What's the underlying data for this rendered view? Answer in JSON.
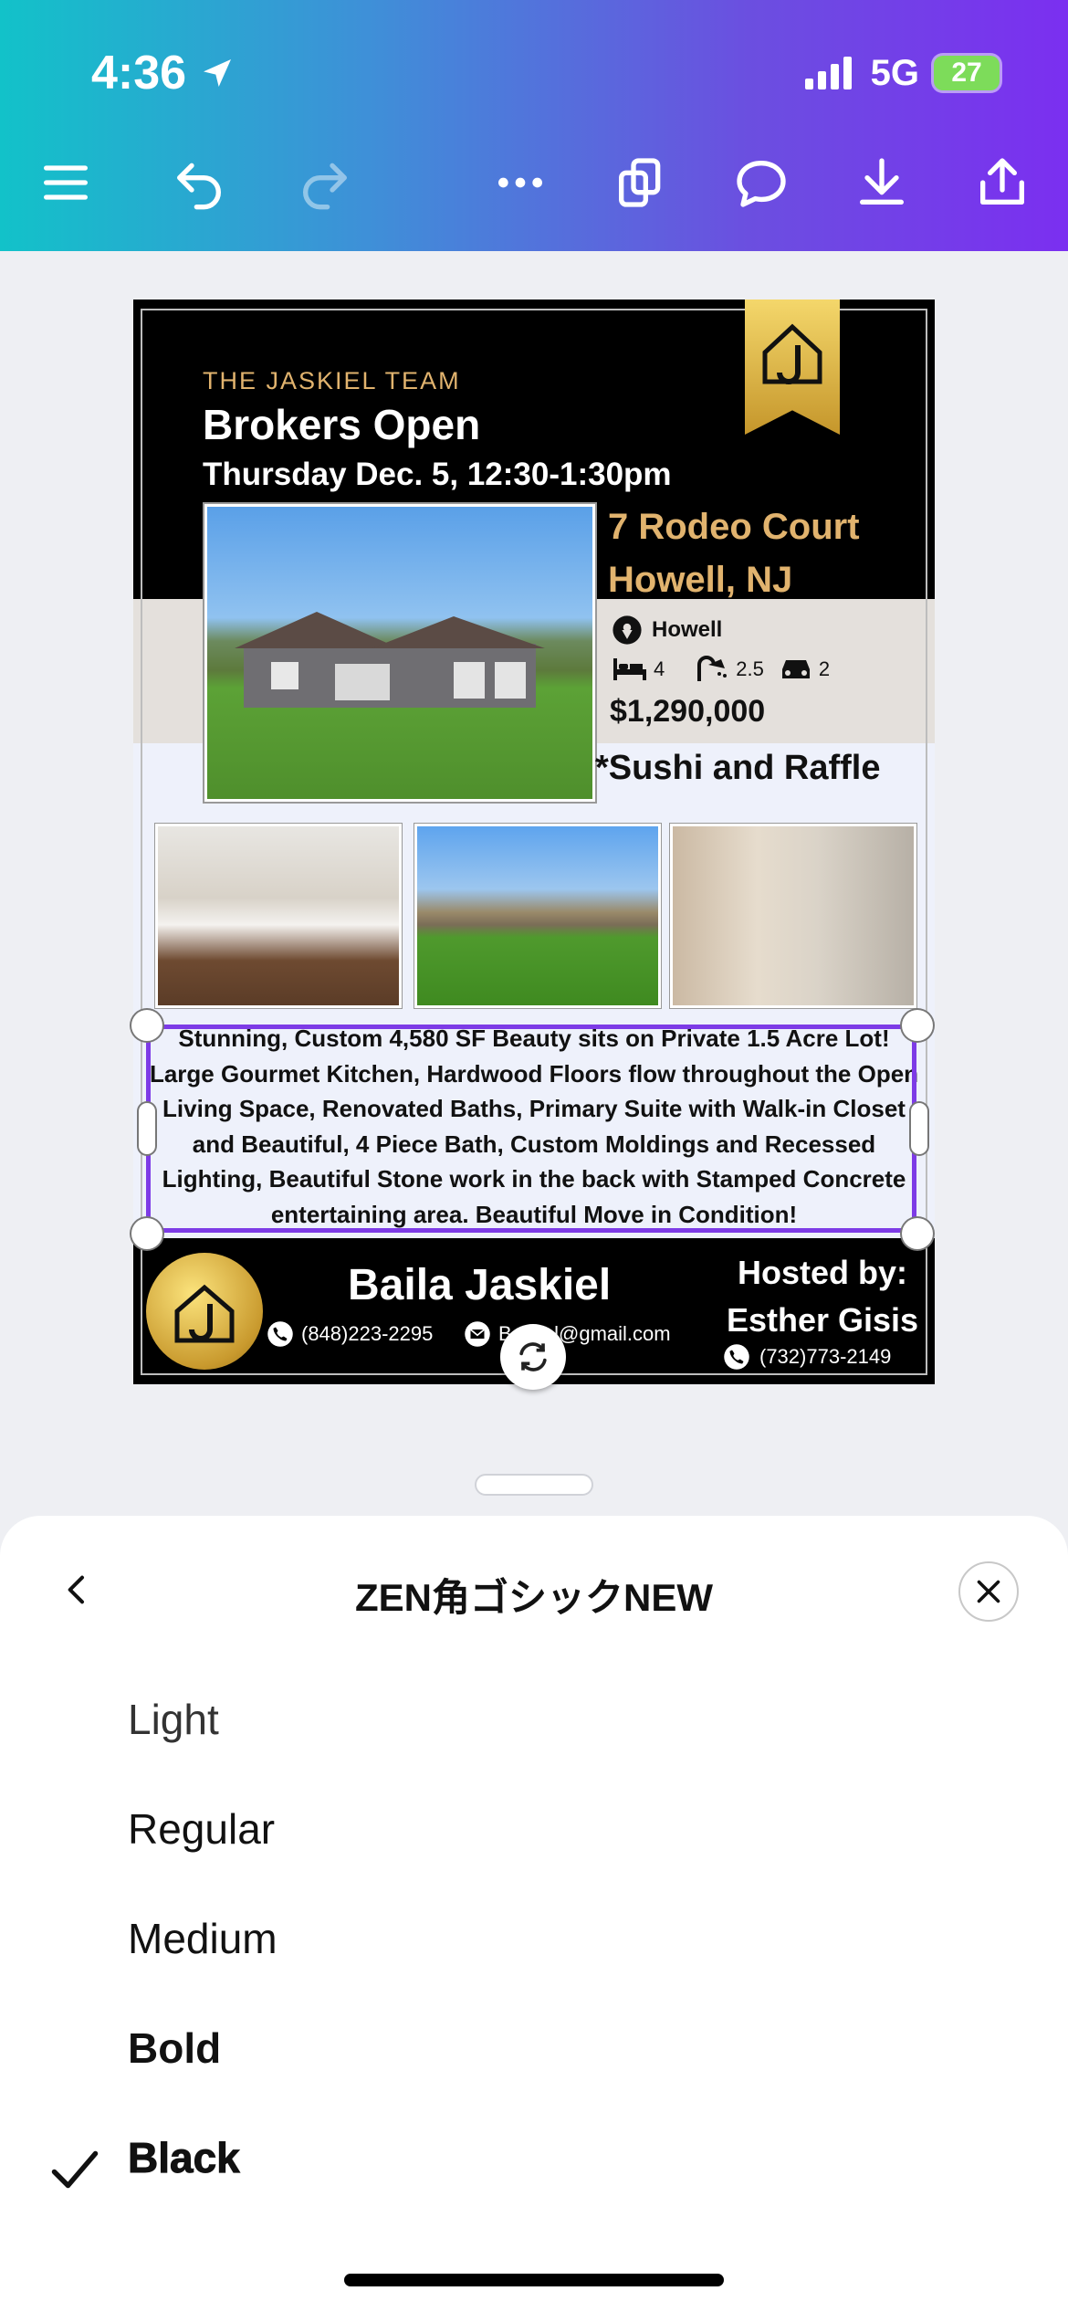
{
  "status_bar": {
    "time": "4:36",
    "network": "5G",
    "battery": "27"
  },
  "toolbar": {
    "menu_icon": "menu-icon",
    "undo_icon": "undo-icon",
    "redo_icon": "redo-icon",
    "more_icon": "more-icon",
    "pages_icon": "pages-icon",
    "comment_icon": "comment-icon",
    "download_icon": "download-icon",
    "share_icon": "share-icon"
  },
  "flyer": {
    "team": "THE JASKIEL TEAM",
    "title": "Brokers Open",
    "datetime": "Thursday Dec. 5, 12:30-1:30pm",
    "address_line1": "7 Rodeo Court",
    "address_line2": "Howell, NJ",
    "location": "Howell",
    "beds": "4",
    "baths": "2.5",
    "garage": "2",
    "price": "$1,290,000",
    "perk": "*Sushi and Raffle",
    "description": "Stunning, Custom 4,580 SF Beauty sits on Private 1.5 Acre Lot! Large Gourmet Kitchen, Hardwood Floors flow throughout the Open Living Space, Renovated Baths, Primary Suite with Walk-in Closet and Beautiful, 4 Piece Bath, Custom Moldings and Recessed Lighting, Beautiful Stone work in the back with Stamped Concrete entertaining area. Beautiful Move in Condition!",
    "logo_text": "THE JASKIEL TEAM",
    "agent_name": "Baila Jaskiel",
    "agent_phone": "(848)223-2295",
    "agent_email": "B...kiel@gmail.com",
    "hosted_label": "Hosted by:",
    "host_name": "Esther Gisis",
    "host_phone": "(732)773-2149"
  },
  "sheet": {
    "title": "ZEN角ゴシックNEW",
    "weights": [
      "Light",
      "Regular",
      "Medium",
      "Bold",
      "Black"
    ],
    "selected": "Black"
  }
}
